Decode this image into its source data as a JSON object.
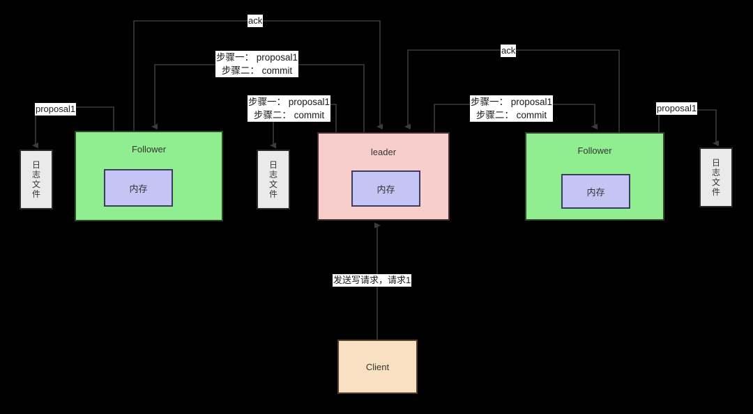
{
  "diagram": {
    "title": "Zab/Raft write request flow",
    "background": "#000000",
    "colors": {
      "follower_fill": "#90EE90",
      "leader_fill": "#F8CECC",
      "memory_fill": "#C5C5F5",
      "logfile_fill": "#EAEAEA",
      "client_fill": "#FAE0C3",
      "edge_stroke": "#3B3B3B",
      "label_background": "#FFFFFF"
    }
  },
  "nodes": {
    "follower_left": {
      "label": "Follower",
      "memory_label": "内存"
    },
    "leader": {
      "label": "leader",
      "memory_label": "内存"
    },
    "follower_right": {
      "label": "Follower",
      "memory_label": "内存"
    },
    "client": {
      "label": "Client"
    },
    "logfile_left": {
      "lines": [
        "日",
        "志",
        "文",
        "件"
      ]
    },
    "logfile_center": {
      "lines": [
        "日",
        "志",
        "文",
        "件"
      ]
    },
    "logfile_right": {
      "lines": [
        "日",
        "志",
        "文",
        "件"
      ]
    }
  },
  "edge_labels": {
    "ack_left": "ack",
    "ack_right": "ack",
    "steps_leader_to_follower_left": "步骤一： proposal1\n步骤二： commit",
    "steps_leader_to_logfile_center": "步骤一： proposal1\n步骤二： commit",
    "steps_leader_to_follower_right": "步骤一： proposal1\n步骤二： commit",
    "proposal_left": "proposal1",
    "proposal_right": "proposal1",
    "client_request": "发送写请求，请求1"
  }
}
